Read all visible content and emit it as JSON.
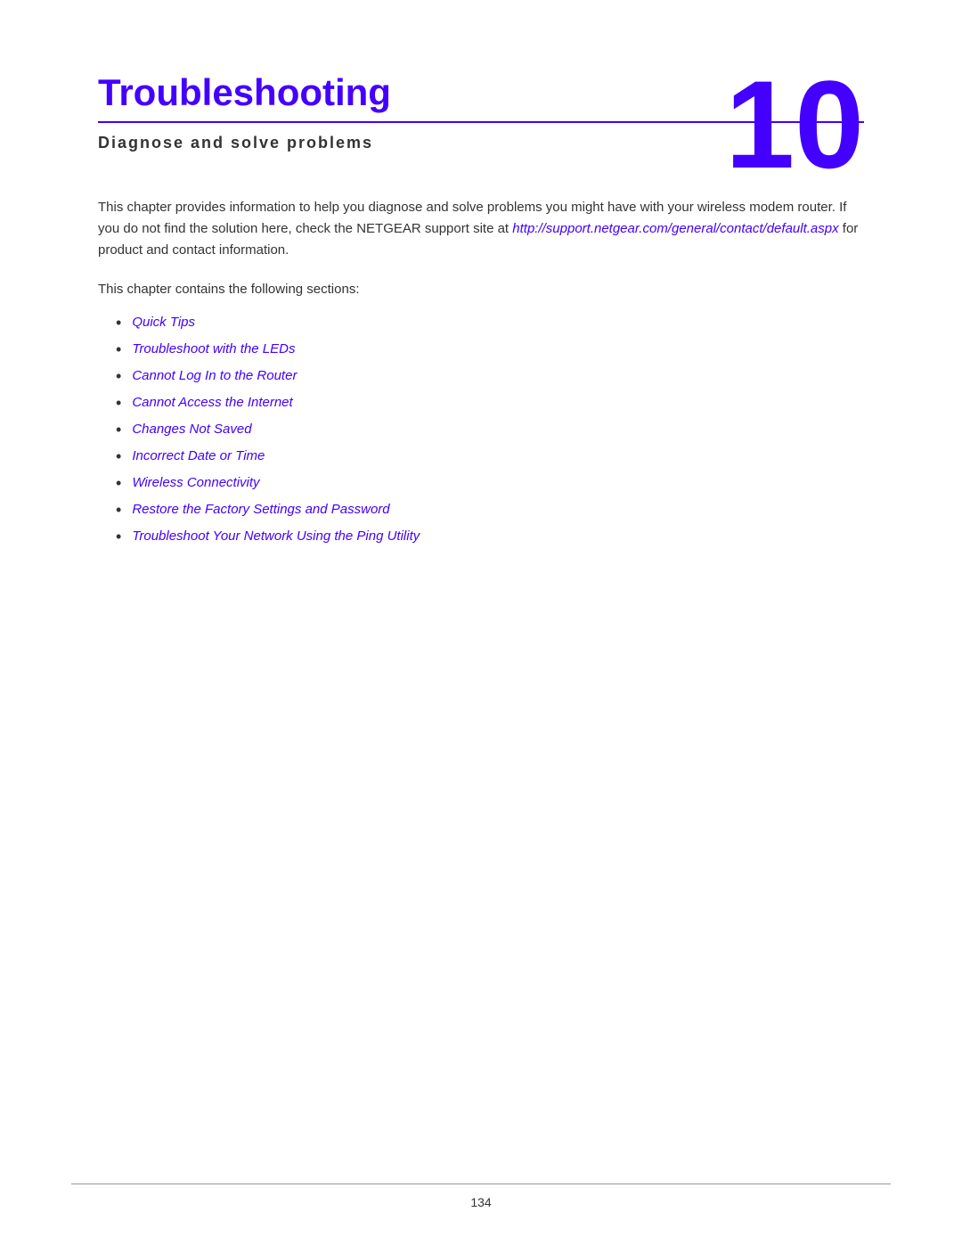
{
  "header": {
    "chapter_number": "10",
    "chapter_title": "Troubleshooting",
    "subtitle": "Diagnose and solve problems"
  },
  "intro": {
    "paragraph1_before_link": "This chapter provides information to help you diagnose and solve problems you might have with your wireless modem router. If you do not find the solution here, check the NETGEAR support site at ",
    "link_text": "http://support.netgear.com/general/contact/default.aspx",
    "paragraph1_after_link": " for product and contact information.",
    "paragraph2": "This chapter contains the following sections:"
  },
  "toc": {
    "items": [
      {
        "label": "Quick Tips"
      },
      {
        "label": "Troubleshoot with the LEDs"
      },
      {
        "label": "Cannot Log In to the Router"
      },
      {
        "label": "Cannot Access the Internet"
      },
      {
        "label": "Changes Not Saved"
      },
      {
        "label": "Incorrect Date or Time"
      },
      {
        "label": "Wireless Connectivity"
      },
      {
        "label": "Restore the Factory Settings and Password"
      },
      {
        "label": "Troubleshoot Your Network Using the Ping Utility"
      }
    ]
  },
  "footer": {
    "page_number": "134"
  }
}
